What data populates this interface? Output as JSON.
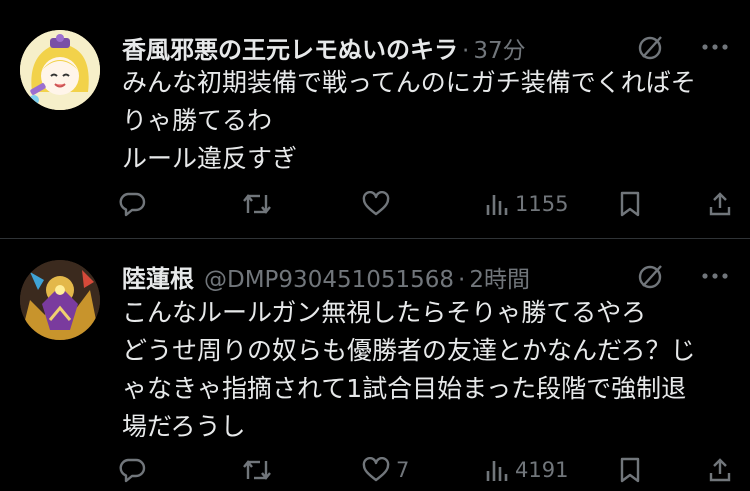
{
  "tweets": [
    {
      "author": "香風邪悪の王元レモぬいのキラ",
      "handle": "",
      "separator": "·",
      "time": "37分",
      "lines": [
        "みんな初期装備で戦ってんのにガチ装備でくればそ",
        "りゃ勝てるわ",
        "ルール違反すぎ"
      ],
      "actions": {
        "reply": "",
        "retweet": "",
        "like": "",
        "views": "1155"
      },
      "icons": [
        "grok-icon",
        "more-icon",
        "reply-icon",
        "retweet-icon",
        "like-icon",
        "views-icon",
        "bookmark-icon",
        "share-icon"
      ]
    },
    {
      "author": "陸蓮根",
      "handle": "@DMP930451051568",
      "separator": "·",
      "time": "2時間",
      "lines": [
        "こんなルールガン無視したらそりゃ勝てるやろ",
        "どうせ周りの奴らも優勝者の友達とかなんだろ？じ",
        "ゃなきゃ指摘されて1試合目始まった段階で強制退",
        "場だろうし"
      ],
      "actions": {
        "reply": "",
        "retweet": "",
        "like": "7",
        "views": "4191"
      },
      "icons": [
        "grok-icon",
        "more-icon",
        "reply-icon",
        "retweet-icon",
        "like-icon",
        "views-icon",
        "bookmark-icon",
        "share-icon"
      ]
    }
  ],
  "colors": {
    "background": "#000000",
    "text": "#e7e9ea",
    "muted": "#71767b",
    "divider": "#2f3336"
  }
}
